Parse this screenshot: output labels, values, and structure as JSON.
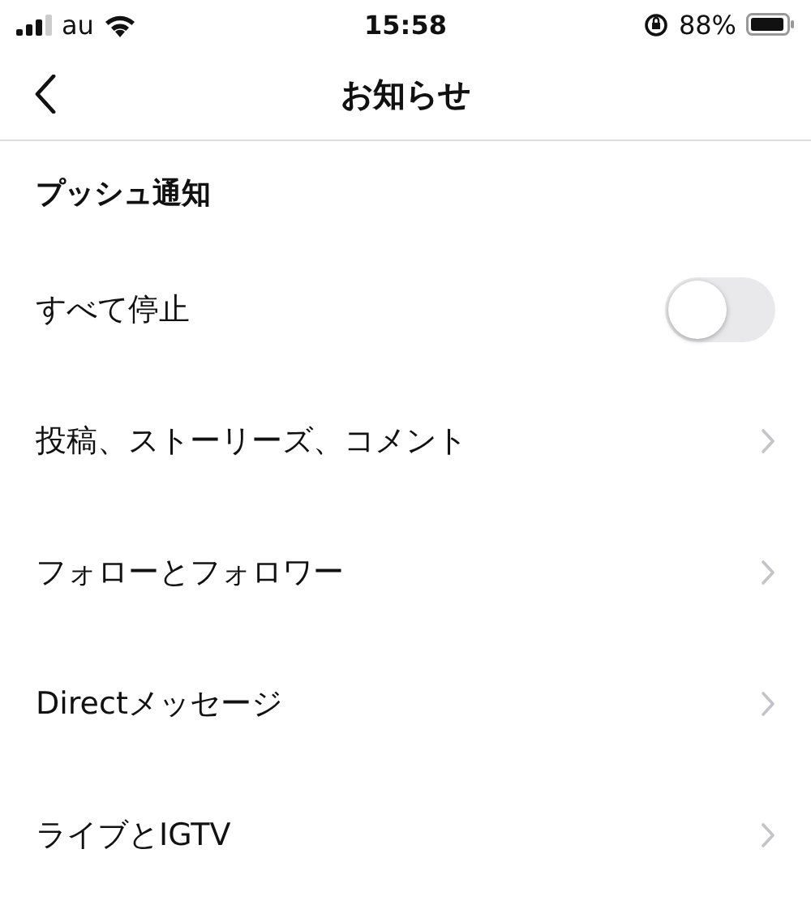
{
  "status_bar": {
    "carrier": "au",
    "time": "15:58",
    "battery": "88%"
  },
  "nav": {
    "title": "お知らせ"
  },
  "section_header": "プッシュ通知",
  "rows": [
    {
      "kind": "toggle",
      "label": "すべて停止",
      "on": false
    },
    {
      "kind": "link",
      "label": "投稿、ストーリーズ、コメント"
    },
    {
      "kind": "link",
      "label": "フォローとフォロワー"
    },
    {
      "kind": "link",
      "label": "Directメッセージ"
    },
    {
      "kind": "link",
      "label": "ライブとIGTV"
    }
  ]
}
